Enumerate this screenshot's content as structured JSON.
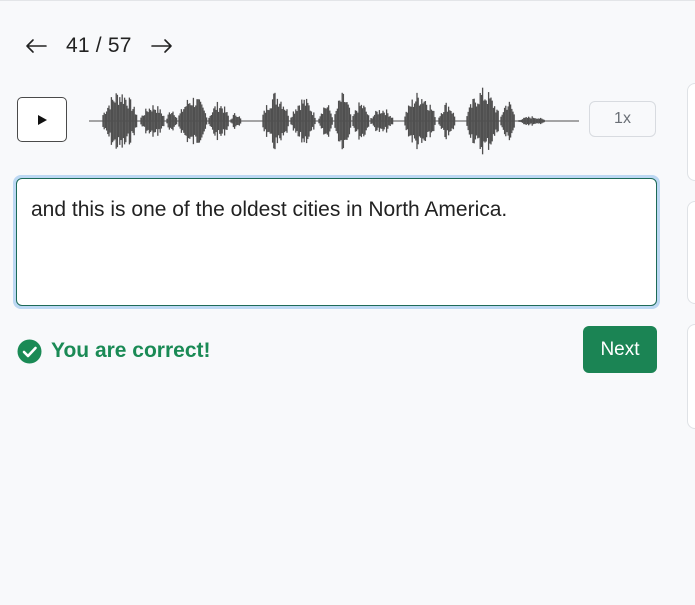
{
  "navigation": {
    "prev_icon": "arrow-left-icon",
    "next_icon": "arrow-right-icon",
    "current": "41",
    "separator": "/",
    "total": "57",
    "counter_text": "41 / 57"
  },
  "player": {
    "play_icon": "play-icon",
    "speed_label": "1x"
  },
  "answer": {
    "text": "and this is one of the oldest cities in North America."
  },
  "feedback": {
    "icon": "check-circle-icon",
    "message": "You are correct!",
    "color": "#1a8a55"
  },
  "actions": {
    "next_label": "Next",
    "accent": "#1b8454"
  },
  "colors": {
    "waveform": "#4f4f4f",
    "focus_ring": "#bcd8f3",
    "input_border": "#1d6b58"
  }
}
